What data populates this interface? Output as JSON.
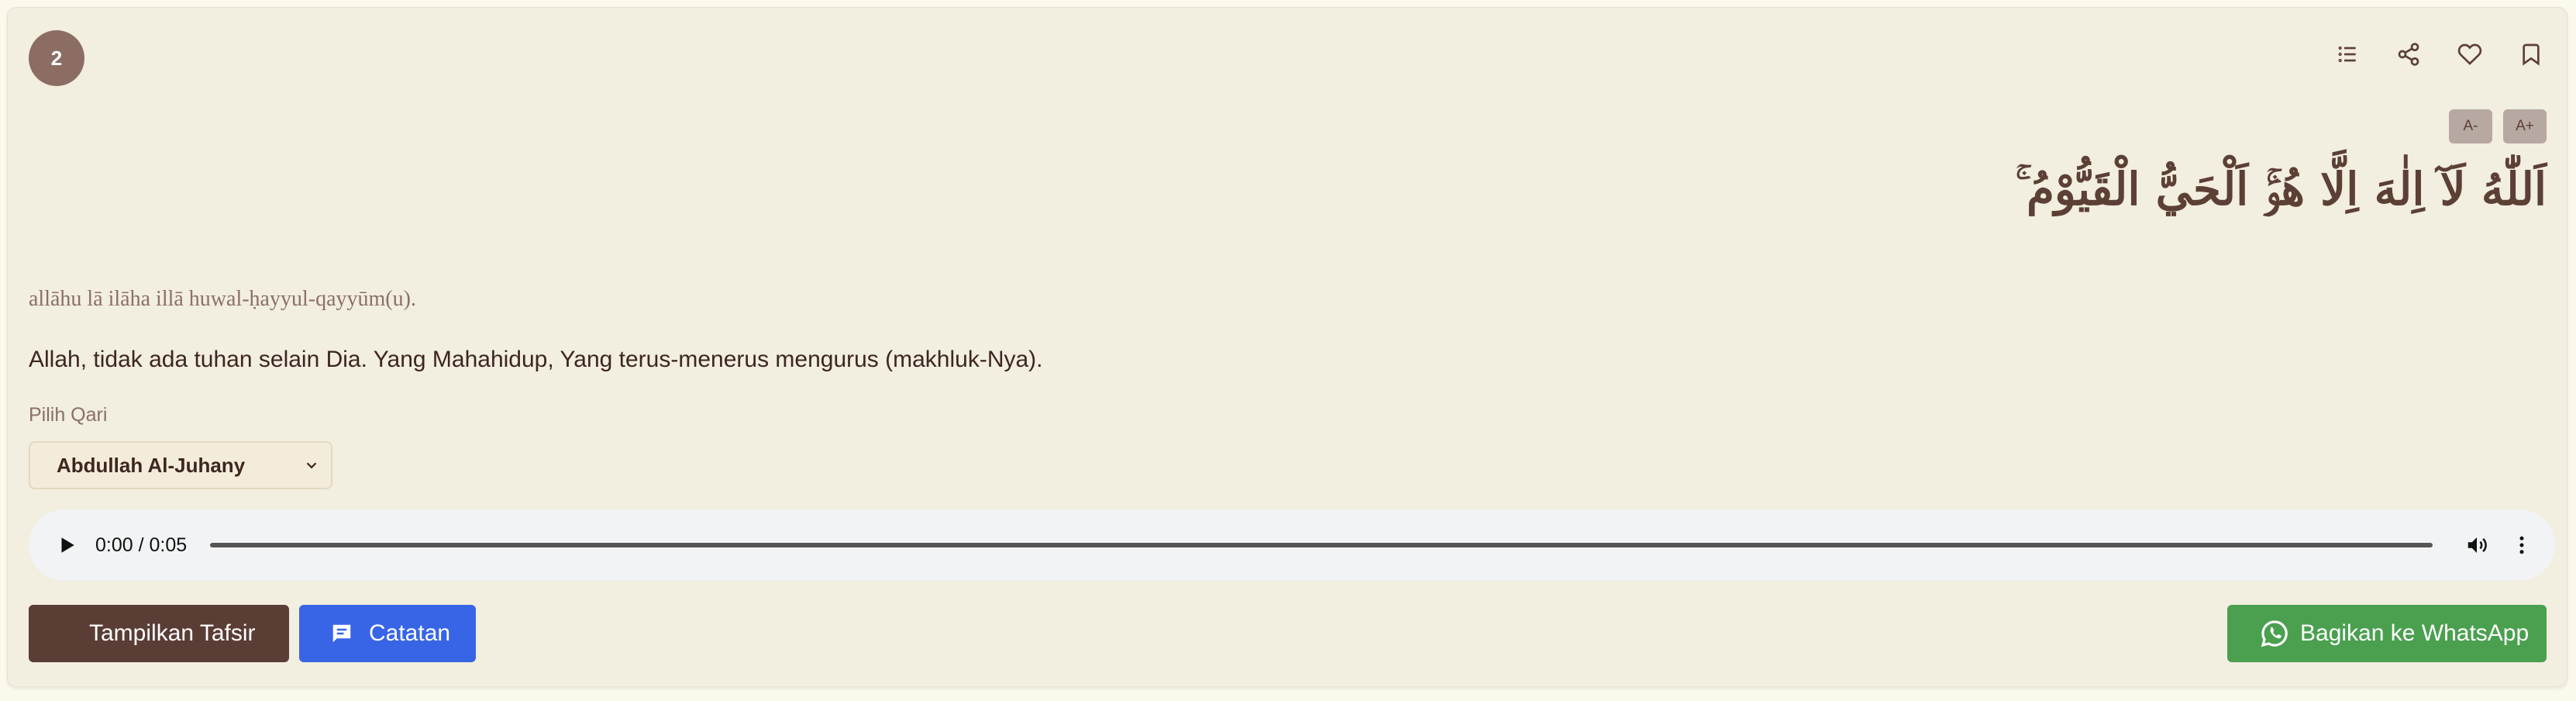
{
  "verse": {
    "number": "2",
    "arabic": "اَللّٰهُ لَآ اِلٰهَ اِلَّا هُوَۚ اَلْحَيُّ الْقَيُّوْمُ ۚ",
    "transliteration": "allāhu lā ilāha illā huwal-ḥayyul-qayyūm(u).",
    "translation": "Allah, tidak ada tuhan selain Dia. Yang Mahahidup, Yang terus-menerus mengurus (makhluk-Nya)."
  },
  "toolbar": {
    "icons": [
      "list-icon",
      "share-icon",
      "heart-icon",
      "bookmark-icon"
    ]
  },
  "font_controls": {
    "decrease": "A-",
    "increase": "A+"
  },
  "qari": {
    "label": "Pilih Qari",
    "selected": "Abdullah Al-Juhany"
  },
  "audio": {
    "time": "0:00 / 0:05"
  },
  "actions": {
    "tafsir": "Tampilkan Tafsir",
    "catatan": "Catatan",
    "whatsapp": "Bagikan ke WhatsApp"
  },
  "colors": {
    "card_bg": "#f2eee0",
    "brown": "#5a3d35",
    "blue": "#3865e5",
    "green": "#4aa04f"
  }
}
